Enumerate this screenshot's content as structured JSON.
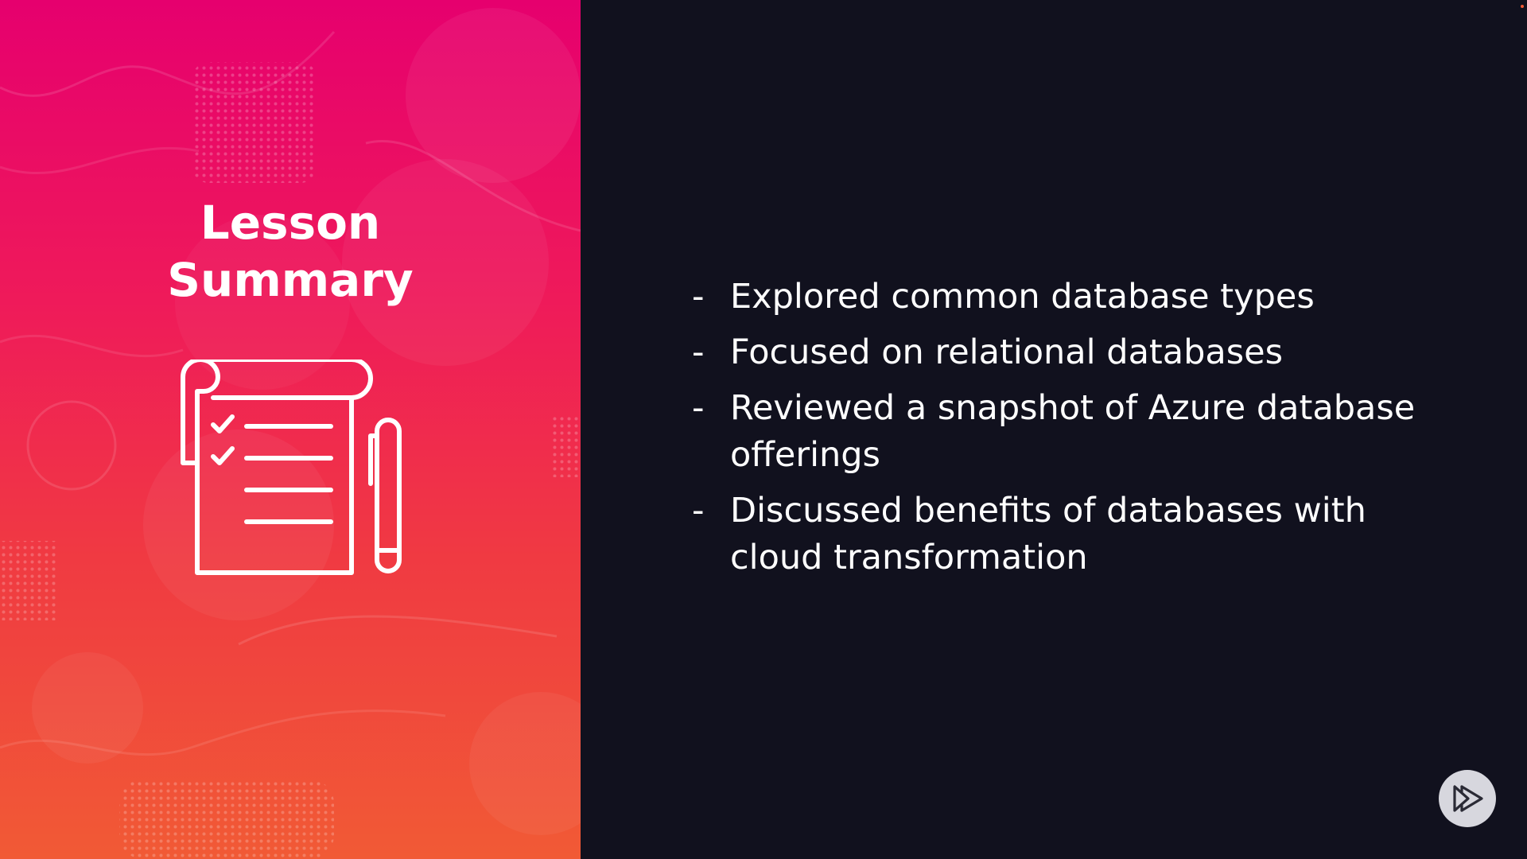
{
  "slide": {
    "title_lines": [
      "Lesson",
      "Summary"
    ],
    "bullet_marker": "-",
    "bullets": [
      "Explored common database types",
      "Focused on relational databases",
      "Reviewed a snapshot of Azure database offerings",
      "Discussed benefits of databases with cloud transformation"
    ]
  },
  "icons": {
    "illustration": "notepad-checklist-with-pen-icon",
    "player_logo": "play-logo-icon"
  },
  "colors": {
    "gradient_top": "#e6006e",
    "gradient_bottom": "#f15a35",
    "background_dark": "#11111e",
    "text": "#ffffff",
    "logo_button": "#d7d7de"
  }
}
